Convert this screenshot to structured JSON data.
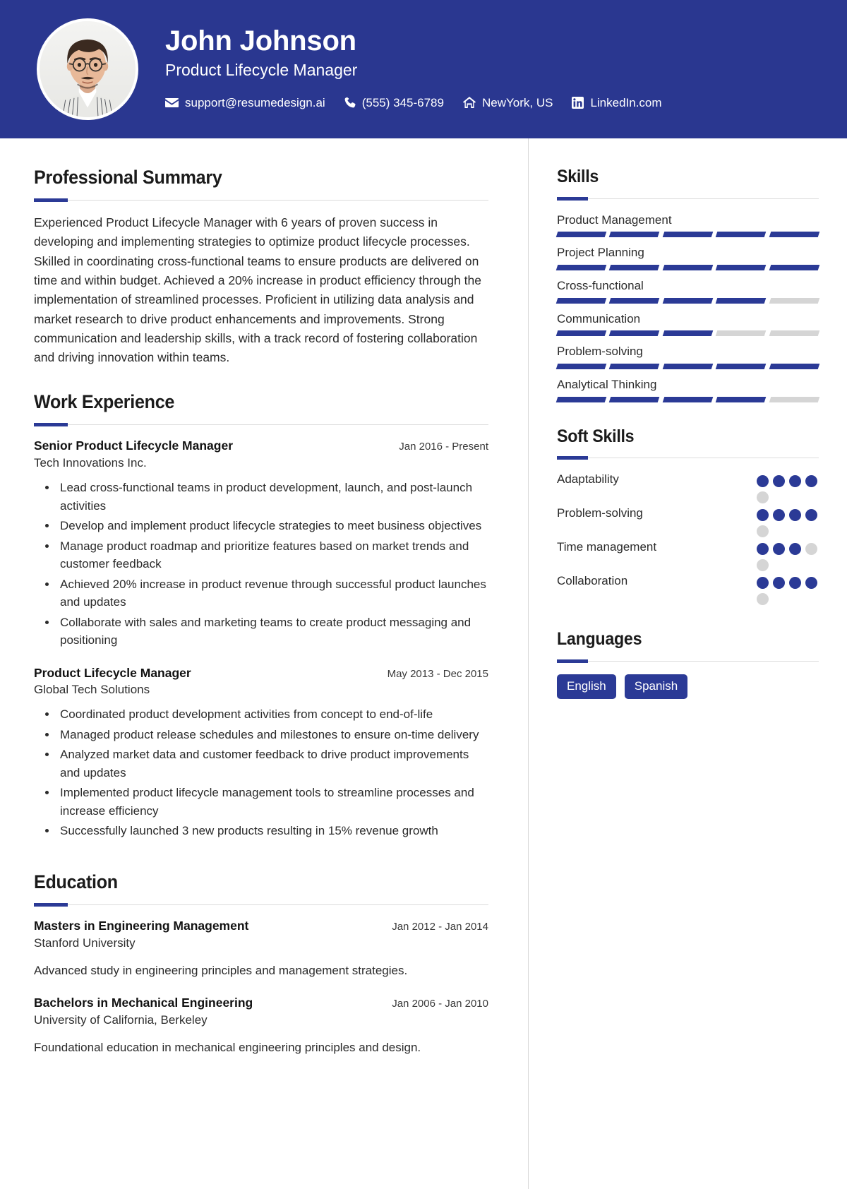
{
  "header": {
    "name": "John Johnson",
    "job_title": "Product Lifecycle Manager",
    "avatar_name": "profile-photo",
    "accent_color": "#2A3790",
    "contacts": [
      {
        "icon": "envelope-icon",
        "text": "support@resumedesign.ai"
      },
      {
        "icon": "phone-icon",
        "text": "(555) 345-6789"
      },
      {
        "icon": "home-icon",
        "text": "NewYork, US"
      },
      {
        "icon": "linkedin-icon",
        "text": "LinkedIn.com"
      }
    ]
  },
  "main": {
    "summary": {
      "heading": "Professional Summary",
      "text": "Experienced Product Lifecycle Manager with 6 years of proven success in developing and implementing strategies to optimize product lifecycle processes. Skilled in coordinating cross-functional teams to ensure products are delivered on time and within budget. Achieved a 20% increase in product efficiency through the implementation of streamlined processes. Proficient in utilizing data analysis and market research to drive product enhancements and improvements. Strong communication and leadership skills, with a track record of fostering collaboration and driving innovation within teams."
    },
    "experience": {
      "heading": "Work Experience",
      "entries": [
        {
          "role": "Senior Product Lifecycle Manager",
          "date": "Jan 2016 - Present",
          "org": "Tech Innovations Inc.",
          "bullets": [
            "Lead cross-functional teams in product development, launch, and post-launch activities",
            "Develop and implement product lifecycle strategies to meet business objectives",
            "Manage product roadmap and prioritize features based on market trends and customer feedback",
            "Achieved 20% increase in product revenue through successful product launches and updates",
            "Collaborate with sales and marketing teams to create product messaging and positioning"
          ]
        },
        {
          "role": "Product Lifecycle Manager",
          "date": "May 2013 - Dec 2015",
          "org": "Global Tech Solutions",
          "bullets": [
            "Coordinated product development activities from concept to end-of-life",
            "Managed product release schedules and milestones to ensure on-time delivery",
            "Analyzed market data and customer feedback to drive product improvements and updates",
            "Implemented product lifecycle management tools to streamline processes and increase efficiency",
            "Successfully launched 3 new products resulting in 15% revenue growth"
          ]
        }
      ]
    },
    "education": {
      "heading": "Education",
      "entries": [
        {
          "degree": "Masters in Engineering Management",
          "date": "Jan 2012 - Jan 2014",
          "school": "Stanford University",
          "description": "Advanced study in engineering principles and management strategies."
        },
        {
          "degree": "Bachelors in Mechanical Engineering",
          "date": "Jan 2006 - Jan 2010",
          "school": "University of California, Berkeley",
          "description": "Foundational education in mechanical engineering principles and design."
        }
      ]
    }
  },
  "sidebar": {
    "skills": {
      "heading": "Skills",
      "max_segments": 5,
      "items": [
        {
          "name": "Product Management",
          "level": 5
        },
        {
          "name": "Project Planning",
          "level": 5
        },
        {
          "name": "Cross-functional",
          "level": 4
        },
        {
          "name": "Communication",
          "level": 3
        },
        {
          "name": "Problem-solving",
          "level": 5
        },
        {
          "name": "Analytical Thinking",
          "level": 4
        }
      ]
    },
    "soft_skills": {
      "heading": "Soft Skills",
      "max_dots": 5,
      "items": [
        {
          "name": "Adaptability",
          "level": 4
        },
        {
          "name": "Problem-solving",
          "level": 4
        },
        {
          "name": "Time management",
          "level": 3
        },
        {
          "name": "Collaboration",
          "level": 4
        }
      ]
    },
    "languages": {
      "heading": "Languages",
      "items": [
        "English",
        "Spanish"
      ]
    },
    "accent_color": "#2b3a96",
    "muted_color": "#d5d5d5"
  }
}
